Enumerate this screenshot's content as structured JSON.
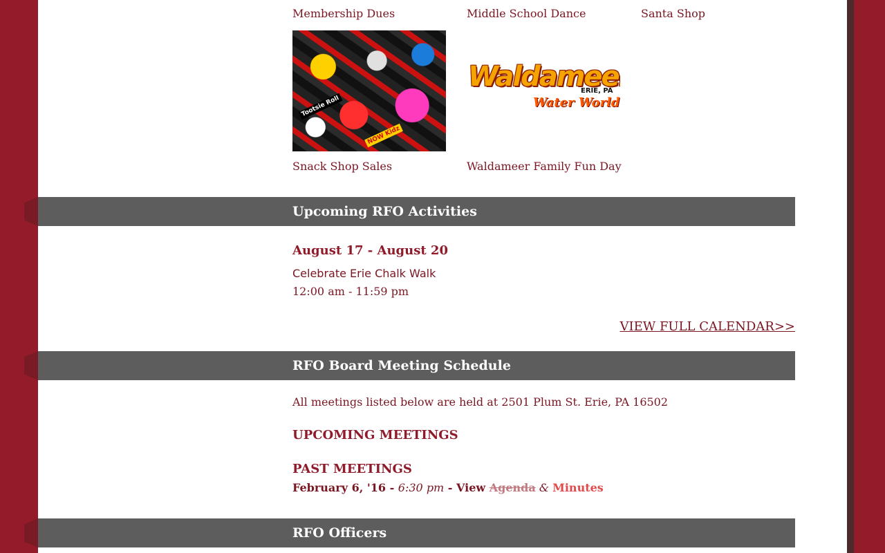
{
  "fundraisers": {
    "items": [
      {
        "label": "Membership Dues"
      },
      {
        "label": "Middle School Dance"
      },
      {
        "label": "Santa Shop"
      },
      {
        "label": "Snack Shop Sales"
      },
      {
        "label": "Waldameer Family Fun Day"
      }
    ],
    "logo": {
      "main": "Waldameer",
      "location": "ERIE, PA",
      "sub": "Water World"
    },
    "candy_labels": [
      "Tootsie Roll",
      "NOW Kidz"
    ]
  },
  "activities": {
    "title": "Upcoming RFO Activities",
    "event_dates": "August 17 - August 20",
    "event_name": "Celebrate Erie Chalk Walk",
    "event_time": "12:00 am - 11:59 pm",
    "calendar_link": "VIEW FULL CALENDAR>>"
  },
  "board": {
    "title": "RFO Board Meeting Schedule",
    "location_note": "All meetings listed below are held at 2501 Plum St. Erie, PA 16502",
    "upcoming_heading": "UPCOMING MEETINGS",
    "past_heading": "PAST MEETINGS",
    "past_meeting": {
      "date": "February 6, '16 - ",
      "time": "6:30 pm",
      "view": " - View ",
      "agenda": "Agenda",
      "amp": " & ",
      "minutes": "Minutes"
    }
  },
  "officers": {
    "title": "RFO Officers"
  },
  "colors": {
    "brand": "#931b2a",
    "bar": "#5d5d5d",
    "text": "#7a1622"
  }
}
